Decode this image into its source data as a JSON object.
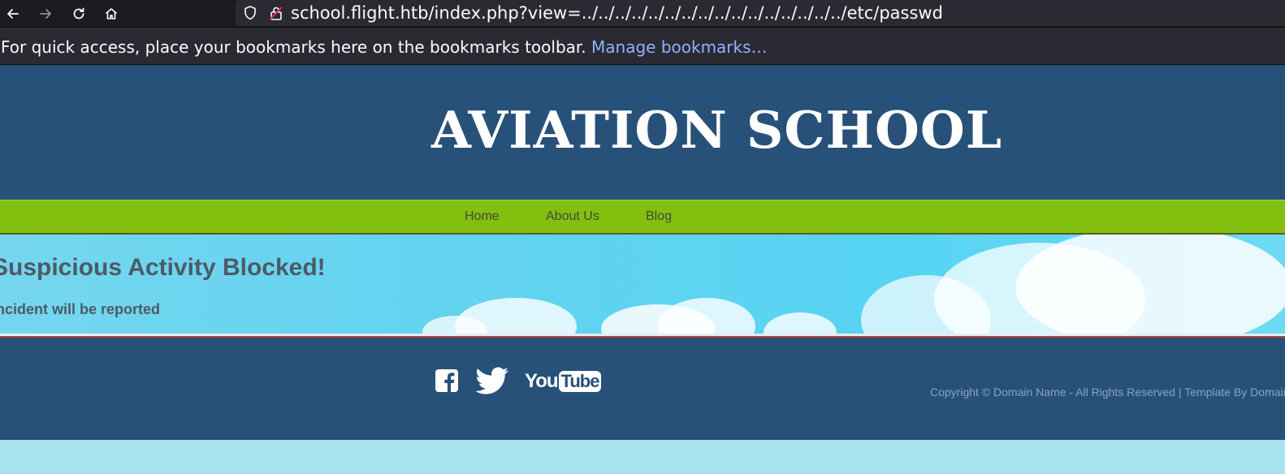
{
  "browser": {
    "url": "school.flight.htb/index.php?view=../../../../../../../../../../../../../../../../etc/passwd",
    "bookmarks_message": "For quick access, place your bookmarks here on the bookmarks toolbar.",
    "bookmarks_link": "Manage bookmarks…"
  },
  "site": {
    "title": "AVIATION SCHOOL",
    "nav": [
      {
        "label": "Home"
      },
      {
        "label": "About Us"
      },
      {
        "label": "Blog"
      }
    ]
  },
  "alert": {
    "heading": "Suspicious Activity Blocked!",
    "message": "Incident will be reported"
  },
  "footer": {
    "social": [
      "facebook-icon",
      "twitter-icon",
      "youtube-icon"
    ],
    "youtube_text": "YouTube",
    "copyright": "Copyright © Domain Name - All Rights Reserved | Template By Domain Name"
  }
}
